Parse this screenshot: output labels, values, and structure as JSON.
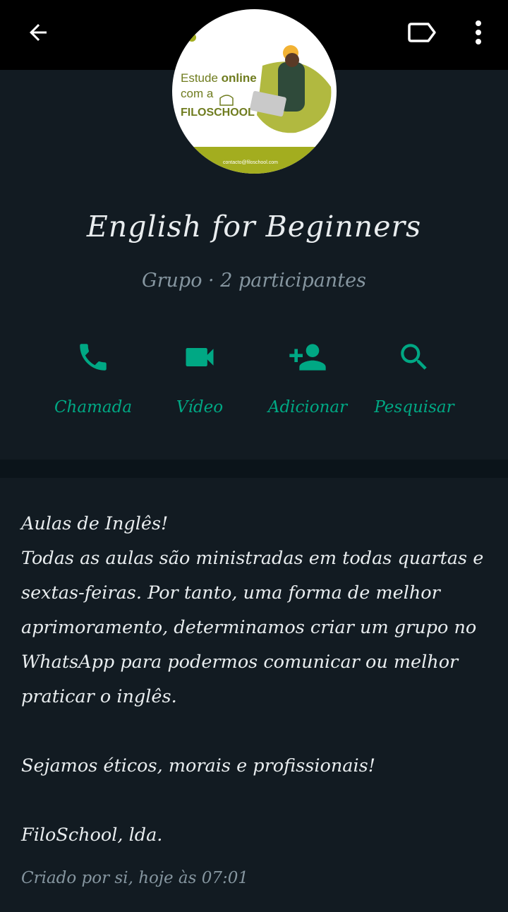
{
  "avatar": {
    "line1_prefix": "Estude ",
    "line1_bold": "online",
    "line2": "com a",
    "brand": "FILOSCHOOL",
    "footer_email": "contacto@filoschool.com"
  },
  "group": {
    "name": "English for Beginners",
    "subtitle": "Grupo · 2 participantes"
  },
  "actions": [
    {
      "label": "Chamada",
      "icon": "phone-icon"
    },
    {
      "label": "Vídeo",
      "icon": "video-camera-icon"
    },
    {
      "label": "Adicionar",
      "icon": "add-person-icon"
    },
    {
      "label": "Pesquisar",
      "icon": "search-icon"
    }
  ],
  "description": {
    "line1": "Aulas de Inglês!",
    "paragraph1": "Todas as aulas são ministradas em todas quartas e sextas-feiras. Por tanto, uma forma de melhor aprimoramento, determinamos criar um grupo no WhatsApp para podermos comunicar ou melhor praticar o inglês.",
    "paragraph2": "Sejamos éticos, morais e profissionais!",
    "signature": "FiloSchool, lda."
  },
  "created": "Criado por si, hoje às 07:01",
  "colors": {
    "accent": "#00a884",
    "background": "#121b22",
    "topbar": "#000000",
    "text": "#e9edef",
    "muted": "#8696a0"
  }
}
